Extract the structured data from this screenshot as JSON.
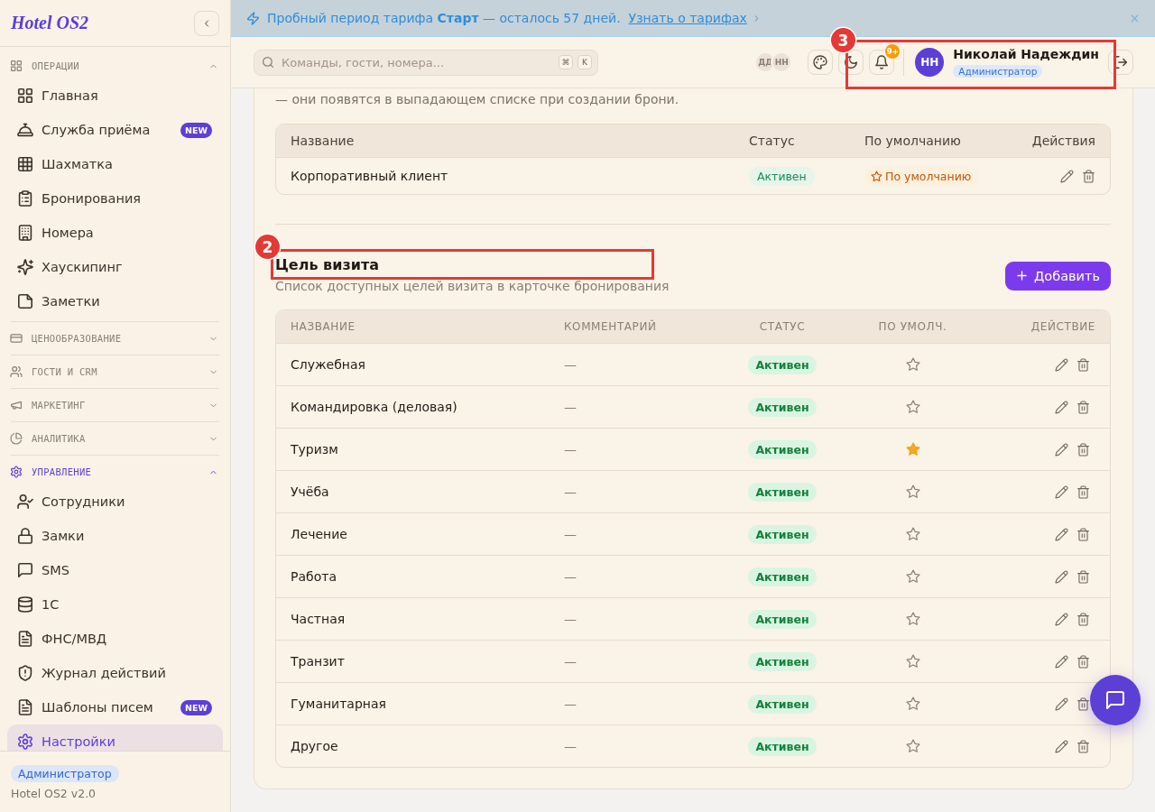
{
  "sidebar": {
    "logo": "Hotel OS2",
    "groups": [
      {
        "title": "ОПЕРАЦИИ",
        "expanded": true,
        "active": false,
        "items": [
          {
            "label": "Главная",
            "selected": false
          },
          {
            "label": "Служба приёма",
            "badge": "NEW",
            "selected": false
          },
          {
            "label": "Шахматка",
            "selected": false
          },
          {
            "label": "Бронирования",
            "selected": false
          },
          {
            "label": "Номера",
            "selected": false
          },
          {
            "label": "Хаускипинг",
            "selected": false
          },
          {
            "label": "Заметки",
            "selected": false
          }
        ]
      },
      {
        "title": "ЦЕНООБРАЗОВАНИЕ",
        "expanded": false,
        "active": false
      },
      {
        "title": "ГОСТИ И CRM",
        "expanded": false,
        "active": false
      },
      {
        "title": "МАРКЕТИНГ",
        "expanded": false,
        "active": false
      },
      {
        "title": "АНАЛИТИКА",
        "expanded": false,
        "active": false
      },
      {
        "title": "УПРАВЛЕНИЕ",
        "expanded": true,
        "active": true,
        "items": [
          {
            "label": "Сотрудники",
            "selected": false
          },
          {
            "label": "Замки",
            "selected": false
          },
          {
            "label": "SMS",
            "selected": false
          },
          {
            "label": "1С",
            "selected": false
          },
          {
            "label": "ФНС/МВД",
            "selected": false
          },
          {
            "label": "Журнал действий",
            "selected": false
          },
          {
            "label": "Шаблоны писем",
            "badge": "NEW",
            "selected": false
          },
          {
            "label": "Настройки",
            "selected": true
          }
        ]
      }
    ],
    "footer": {
      "role": "Администратор",
      "version": "Hotel OS2 v2.0"
    }
  },
  "banner": {
    "text": "Пробный период тарифа **Старт** — осталось 57 дней.",
    "link": "Узнать о тарифах"
  },
  "topbar": {
    "search": {
      "placeholder": "Команды, гости, номера...",
      "shortcut": [
        "⌘",
        "K"
      ]
    },
    "online_users": [
      "ДД",
      "НН"
    ],
    "notification_count": "9+",
    "user": {
      "initials": "НН",
      "name": "Николай Надеждин",
      "role": "Администратор"
    },
    "annotation": "3"
  },
  "content": {
    "intro": "— они появятся в выпадающем списке при создании брони.",
    "client_types": {
      "columns": [
        "Название",
        "Статус",
        "По умолчанию",
        "Действия"
      ],
      "rows": [
        {
          "name": "Корпоративный клиент",
          "status": "Активен",
          "default_badge": "По умолчанию"
        }
      ]
    },
    "visit_purpose": {
      "title": "Цель визита",
      "annotation": "2",
      "subtitle": "Список доступных целей визита в карточке бронирования",
      "add_button": "Добавить",
      "table": {
        "columns": [
          "НАЗВАНИЕ",
          "КОММЕНТАРИЙ",
          "СТАТУС",
          "ПО УМОЛЧ.",
          "ДЕЙСТВИЕ"
        ],
        "rows": [
          {
            "name": "Служебная",
            "comment": "—",
            "status": "Активен",
            "default": false
          },
          {
            "name": "Командировка (деловая)",
            "comment": "—",
            "status": "Активен",
            "default": false
          },
          {
            "name": "Туризм",
            "comment": "—",
            "status": "Активен",
            "default": true
          },
          {
            "name": "Учёба",
            "comment": "—",
            "status": "Активен",
            "default": false
          },
          {
            "name": "Лечение",
            "comment": "—",
            "status": "Активен",
            "default": false
          },
          {
            "name": "Работа",
            "comment": "—",
            "status": "Активен",
            "default": false
          },
          {
            "name": "Частная",
            "comment": "—",
            "status": "Активен",
            "default": false
          },
          {
            "name": "Транзит",
            "comment": "—",
            "status": "Активен",
            "default": false
          },
          {
            "name": "Гуманитарная",
            "comment": "—",
            "status": "Активен",
            "default": false
          },
          {
            "name": "Другое",
            "comment": "—",
            "status": "Активен",
            "default": false
          }
        ]
      }
    }
  }
}
